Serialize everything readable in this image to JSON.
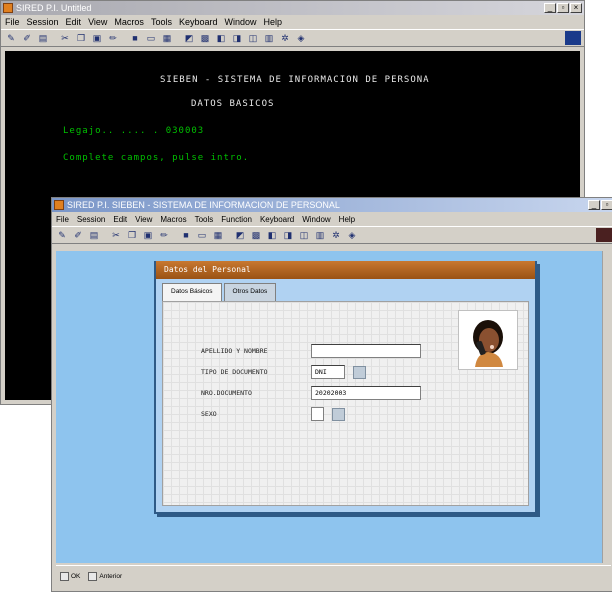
{
  "back_window": {
    "title": "SIRED P.I. Untitled",
    "menu": [
      "File",
      "Session",
      "Edit",
      "View",
      "Macros",
      "Tools",
      "Keyboard",
      "Window",
      "Help"
    ],
    "terminal": {
      "title": "SIEBEN - SISTEMA DE INFORMACION DE PERSONA",
      "subtitle": "DATOS BASICOS",
      "legajo_line": "Legajo.. .... . 030003",
      "message": "Complete campos, pulse intro."
    }
  },
  "front_window": {
    "title": "SIRED P.I. SIEBEN - SISTEMA DE INFORMACION DE PERSONAL",
    "menu": [
      "File",
      "Session",
      "Edit",
      "View",
      "Macros",
      "Tools",
      "Function",
      "Keyboard",
      "Window",
      "Help"
    ],
    "panel_title": "Datos del Personal",
    "tabs": [
      "Datos Básicos",
      "Otros Datos"
    ],
    "fields": [
      {
        "label": "APELLIDO Y NOMBRE",
        "value": ""
      },
      {
        "label": "TIPO DE DOCUMENTO",
        "value": "DNI"
      },
      {
        "label": "NRO.DOCUMENTO",
        "value": "20202003"
      },
      {
        "label": "SEXO",
        "value": ""
      }
    ],
    "status_buttons": [
      "OK",
      "Anterior"
    ]
  },
  "colors": {
    "panel_header": "#b5651d",
    "canvas": "#8ec4ee",
    "terminal_green": "#00c000"
  }
}
